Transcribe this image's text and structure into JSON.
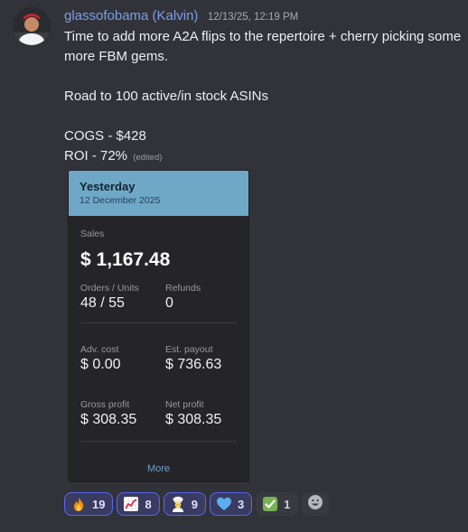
{
  "message": {
    "username": "glassofobama (Kalvin)",
    "timestamp": "12/13/25, 12:19 PM",
    "lines": [
      "Time to add more A2A flips to the repertoire + cherry picking some more FBM gems.",
      "Road to 100 active/in stock ASINs",
      "COGS - $428",
      "ROI - 72%"
    ],
    "edited_label": "(edited)"
  },
  "card": {
    "header_title": "Yesterday",
    "header_date": "12 December 2025",
    "sales_label": "Sales",
    "sales_value": "$ 1,167.48",
    "orders_label": "Orders / Units",
    "orders_value": "48 / 55",
    "refunds_label": "Refunds",
    "refunds_value": "0",
    "adv_label": "Adv. cost",
    "adv_value": "$ 0.00",
    "payout_label": "Est. payout",
    "payout_value": "$ 736.63",
    "gross_label": "Gross profit",
    "gross_value": "$ 308.35",
    "net_label": "Net profit",
    "net_value": "$ 308.35",
    "more_label": "More",
    "header_color": "#6fa8c7"
  },
  "reactions": [
    {
      "emoji": "fire-emoji",
      "count": "19",
      "reacted": true
    },
    {
      "emoji": "chart-increasing-emoji",
      "count": "8",
      "reacted": true
    },
    {
      "emoji": "cook-emoji",
      "count": "9",
      "reacted": true
    },
    {
      "emoji": "blue-heart-emoji",
      "count": "3",
      "reacted": true
    },
    {
      "emoji": "check-mark-button-emoji",
      "count": "1",
      "reacted": false
    }
  ],
  "colors": {
    "background": "#323339",
    "username": "#7a9eea",
    "reaction_active_border": "#5865f2"
  }
}
